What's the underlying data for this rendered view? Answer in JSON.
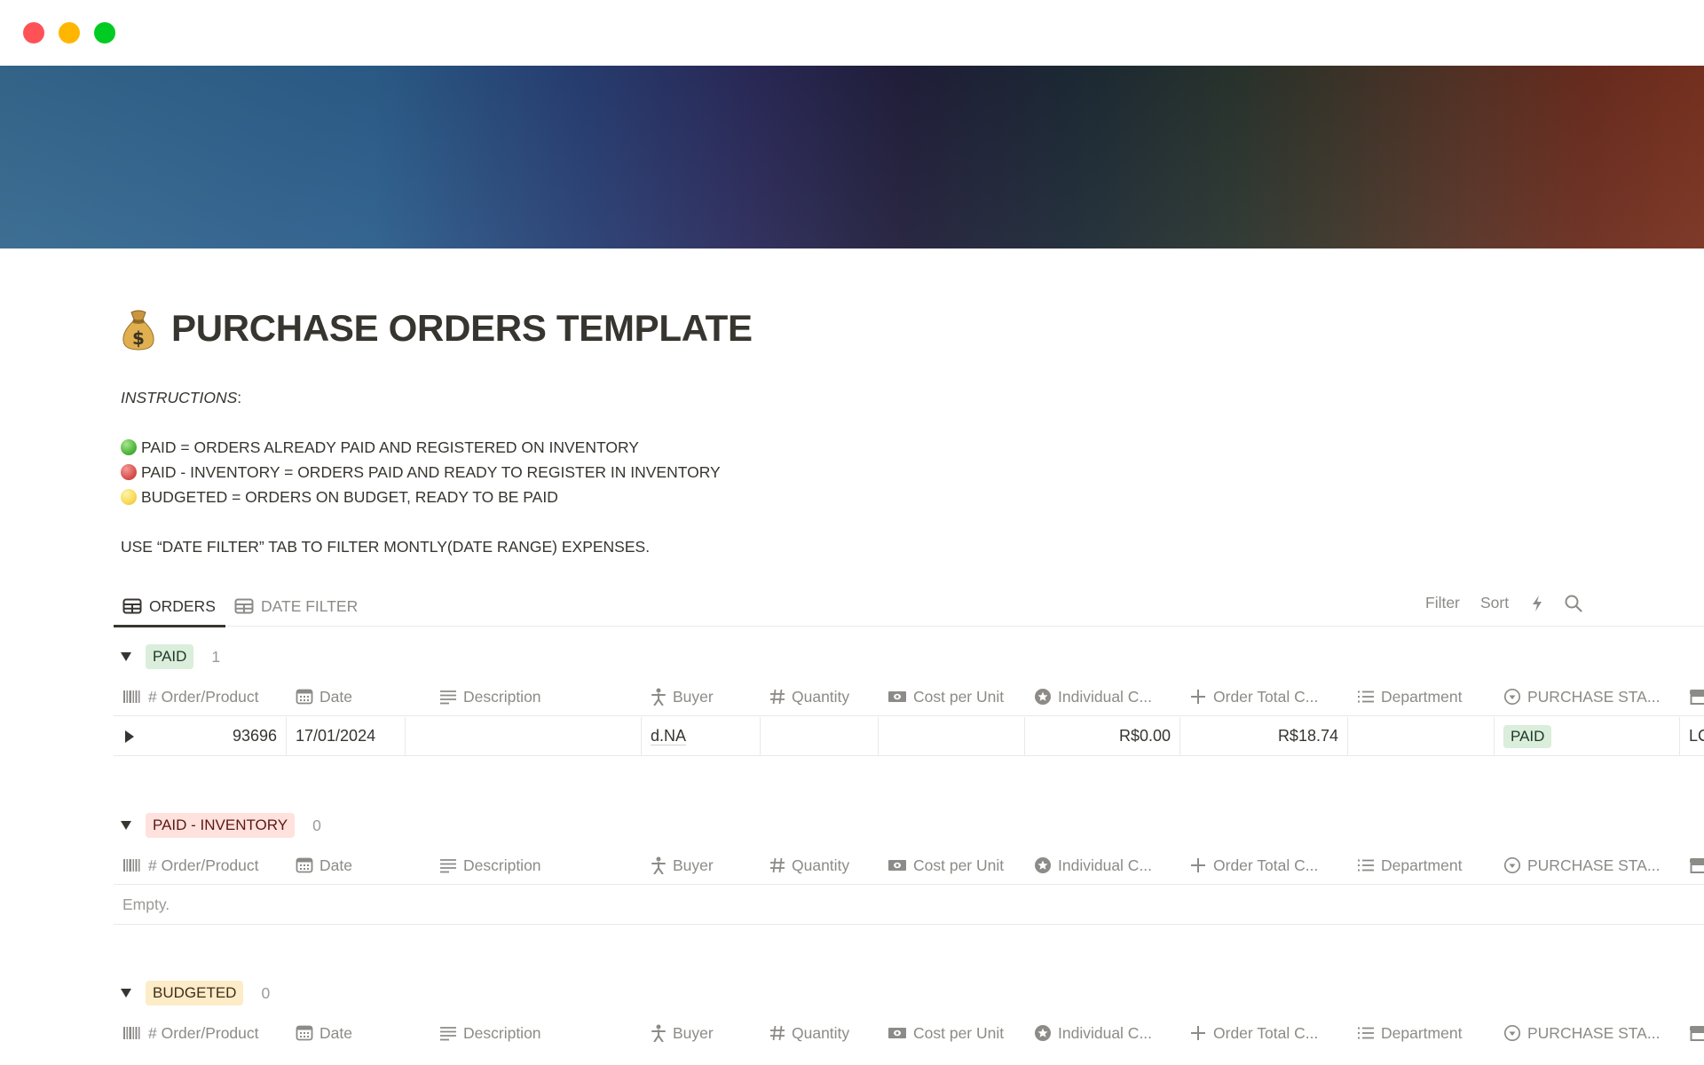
{
  "window": {
    "controls": [
      "close",
      "minimize",
      "zoom"
    ]
  },
  "page": {
    "icon": "money-bag-icon",
    "title": "PURCHASE ORDERS TEMPLATE",
    "instructions_label": "INSTRUCTIONS",
    "instructions_colon": ":",
    "legend": [
      {
        "color": "green",
        "text": "PAID = ORDERS ALREADY PAID AND REGISTERED ON INVENTORY"
      },
      {
        "color": "red",
        "text": "PAID - INVENTORY = ORDERS PAID AND READY TO REGISTER IN INVENTORY"
      },
      {
        "color": "yellow",
        "text": "BUDGETED = ORDERS ON BUDGET, READY TO BE PAID"
      }
    ],
    "note": "USE “DATE FILTER” TAB TO FILTER MONTLY(DATE RANGE) EXPENSES."
  },
  "views": {
    "tabs": [
      {
        "label": "ORDERS",
        "icon": "table-icon",
        "active": true
      },
      {
        "label": "DATE FILTER",
        "icon": "table-icon",
        "active": false
      }
    ],
    "tools": {
      "filter": "Filter",
      "sort": "Sort",
      "automation_icon": "lightning-icon",
      "search_icon": "search-icon"
    }
  },
  "columns": [
    {
      "label": "# Order/Product",
      "icon": "barcode-icon"
    },
    {
      "label": "Date",
      "icon": "calendar-icon"
    },
    {
      "label": "Description",
      "icon": "text-lines-icon"
    },
    {
      "label": "Buyer",
      "icon": "person-icon"
    },
    {
      "label": "Quantity",
      "icon": "number-icon"
    },
    {
      "label": "Cost per Unit",
      "icon": "money-icon"
    },
    {
      "label": "Individual C...",
      "icon": "formula-star-icon"
    },
    {
      "label": "Order Total C...",
      "icon": "plus-icon"
    },
    {
      "label": "Department",
      "icon": "list-icon"
    },
    {
      "label": "PURCHASE STA...",
      "icon": "status-icon"
    },
    {
      "label": "",
      "icon": "store-icon"
    }
  ],
  "groups": [
    {
      "name": "PAID",
      "count": "1",
      "color": "#dbeddb",
      "rows": [
        {
          "order": "93696",
          "date": "17/01/2024",
          "description": "",
          "buyer": "d.NA",
          "quantity": "",
          "cost_per_unit": "",
          "individual_cost": "R$0.00",
          "order_total": "R$18.74",
          "department": "",
          "status": "PAID",
          "extra": "LC"
        }
      ]
    },
    {
      "name": "PAID - INVENTORY",
      "count": "0",
      "color": "#ffe2dd",
      "empty_label": "Empty."
    },
    {
      "name": "BUDGETED",
      "count": "0",
      "color": "#fdecc8"
    }
  ]
}
